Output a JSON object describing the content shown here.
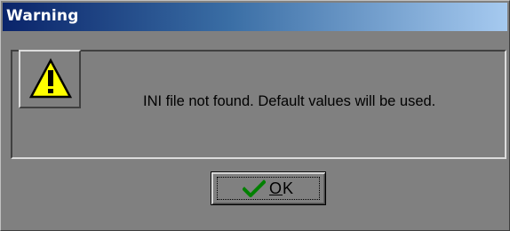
{
  "window": {
    "title": "Warning"
  },
  "dialog": {
    "icon": "warning-triangle-icon",
    "message": "INI file not found. Default values will be used."
  },
  "buttons": {
    "ok": {
      "icon": "checkmark-icon",
      "mnemonic": "O",
      "rest": "K"
    }
  },
  "colors": {
    "background": "#808080",
    "title_start": "#0a246a",
    "title_end": "#a6caf0",
    "warning_yellow": "#ffff00",
    "checkmark_green": "#008000"
  }
}
